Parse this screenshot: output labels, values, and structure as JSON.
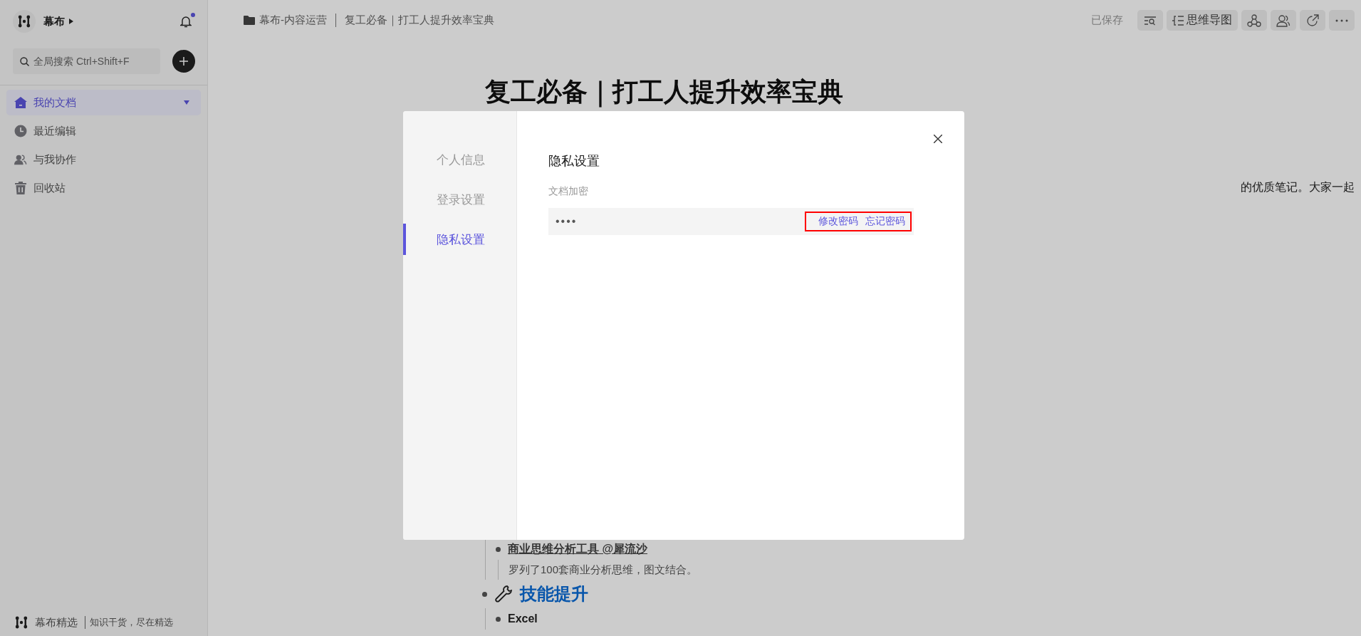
{
  "sidebar": {
    "brand": "幕布",
    "has_unread": true,
    "search": {
      "placeholder": "全局搜索 Ctrl+Shift+F"
    },
    "items": [
      {
        "kind": "home",
        "label": "我的文档",
        "selected": true
      },
      {
        "kind": "clock",
        "label": "最近编辑",
        "selected": false
      },
      {
        "kind": "people",
        "label": "与我协作",
        "selected": false
      },
      {
        "kind": "trash",
        "label": "回收站",
        "selected": false
      }
    ],
    "footer": {
      "title": "幕布精选",
      "tagline": "知识干货，尽在精选"
    }
  },
  "topbar": {
    "breadcrumb": [
      "幕布-内容运营",
      "复工必备｜打工人提升效率宝典"
    ],
    "status": "已保存",
    "tools": [
      {
        "kind": "outline-search"
      },
      {
        "kind": "mindmap",
        "label": "思维导图"
      },
      {
        "kind": "graph"
      },
      {
        "kind": "collaborate"
      },
      {
        "kind": "share"
      },
      {
        "kind": "more"
      }
    ]
  },
  "document": {
    "title": "复工必备｜打工人提升效率宝典",
    "intro_fragment": "的优质笔记。大家一起",
    "items": [
      {
        "kind": "link-item",
        "text": "商业思维分析工具 @犀流沙",
        "note": "罗列了100套商业分析思维，图文结合。"
      },
      {
        "kind": "heading",
        "text": "技能提升"
      },
      {
        "kind": "item",
        "text": "Excel"
      }
    ]
  },
  "modal": {
    "nav": [
      {
        "label": "个人信息",
        "selected": false
      },
      {
        "label": "登录设置",
        "selected": false
      },
      {
        "label": "隐私设置",
        "selected": true
      }
    ],
    "heading": "隐私设置",
    "field_label": "文档加密",
    "password_mask": "••••",
    "links": [
      "修改密码",
      "忘记密码"
    ],
    "highlighted": true
  }
}
